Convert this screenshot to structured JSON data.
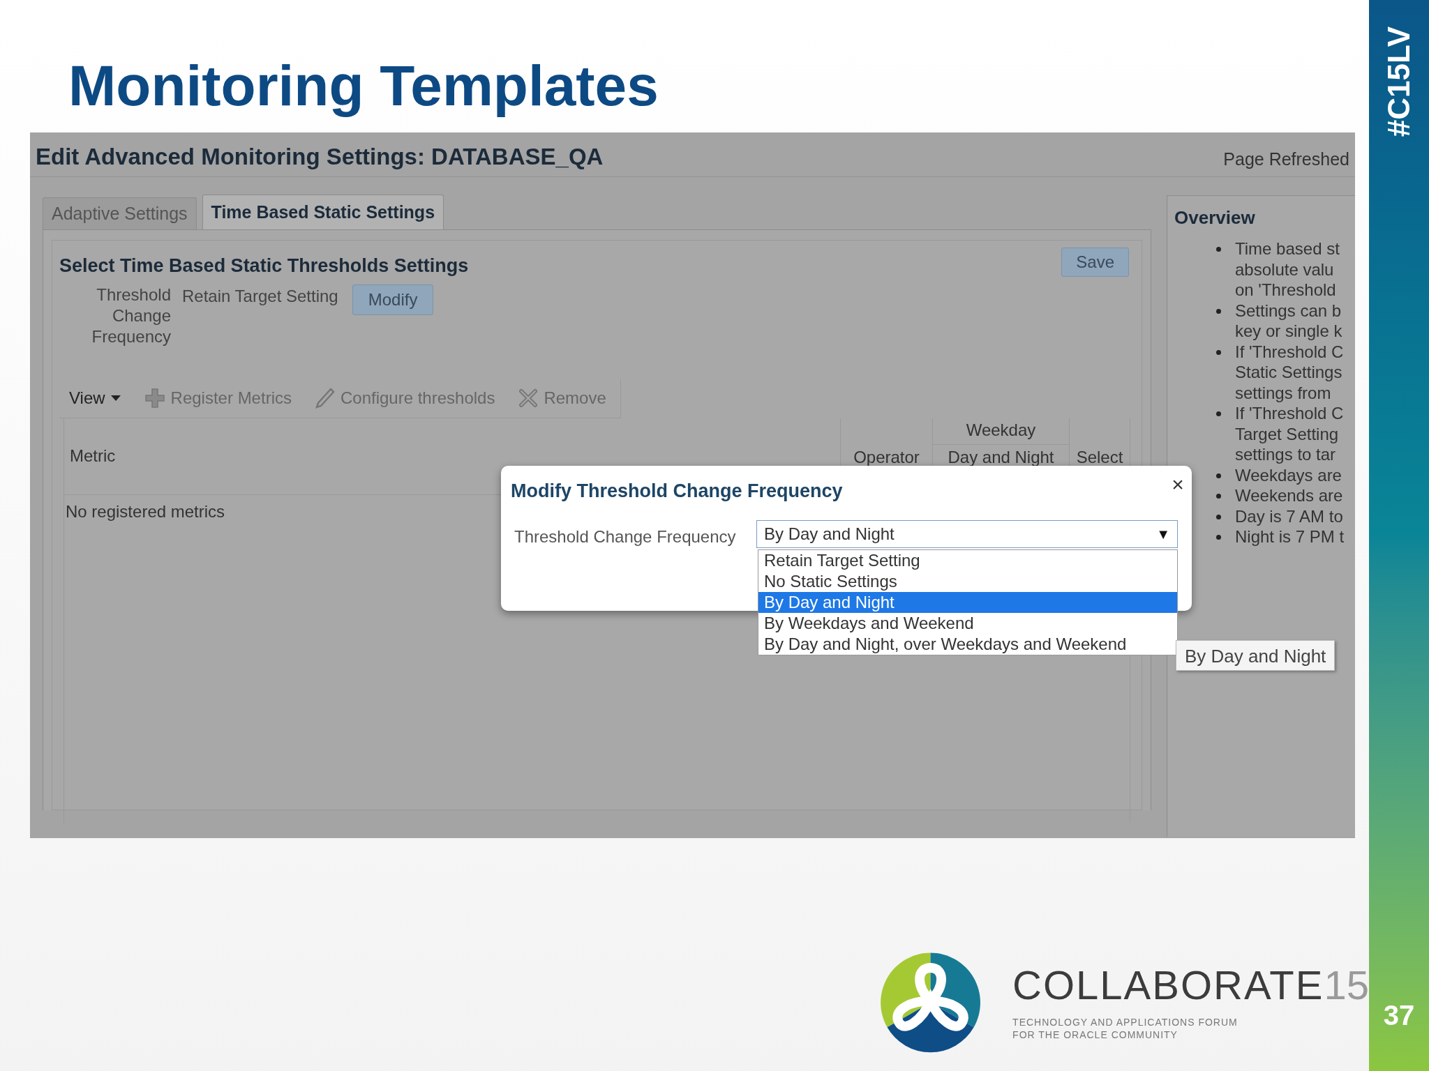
{
  "slide": {
    "title": "Monitoring Templates",
    "hashtag": "#C15LV",
    "page_number": "37"
  },
  "page": {
    "title": "Edit Advanced Monitoring Settings: DATABASE_QA",
    "refresh_label": "Page Refreshed",
    "tabs": [
      {
        "label": "Adaptive Settings",
        "selected": false
      },
      {
        "label": "Time Based Static Settings",
        "selected": true
      }
    ],
    "section": {
      "title": "Select Time Based Static Thresholds Settings",
      "save_button": "Save",
      "field_label": "Threshold Change Frequency",
      "field_value": "Retain Target Setting",
      "modify_button": "Modify"
    },
    "toolbar": [
      {
        "kind": "menu",
        "label": "View",
        "disabled": false
      },
      {
        "kind": "register",
        "label": "Register Metrics",
        "disabled": true
      },
      {
        "kind": "edit",
        "label": "Configure thresholds",
        "disabled": true
      },
      {
        "kind": "remove",
        "label": "Remove",
        "disabled": true
      }
    ],
    "table": {
      "columns": [
        {
          "label": "Metric"
        },
        {
          "label": "Operator"
        },
        {
          "group": "Weekday",
          "label": "Day and Night"
        },
        {
          "label": "Select"
        }
      ],
      "empty_text": "No registered metrics"
    }
  },
  "overview": {
    "title": "Overview",
    "items": [
      {
        "lines": [
          "Time based st",
          "absolute valu",
          "on 'Threshold"
        ]
      },
      {
        "lines": [
          "Settings can b",
          "key or single k"
        ]
      },
      {
        "lines": [
          "If 'Threshold C",
          "Static Settings",
          "settings from"
        ]
      },
      {
        "lines": [
          "If 'Threshold C",
          "Target Setting",
          "settings to tar"
        ]
      },
      {
        "lines": [
          "Weekdays are"
        ]
      },
      {
        "lines": [
          "Weekends are"
        ]
      },
      {
        "lines": [
          "Day is 7 AM to"
        ]
      },
      {
        "lines": [
          "Night is 7 PM t"
        ]
      }
    ]
  },
  "dialog": {
    "title": "Modify Threshold Change Frequency",
    "label": "Threshold Change Frequency",
    "value": "By Day and Night",
    "arrow": "▼",
    "close": "×",
    "options": [
      {
        "label": "Retain Target Setting",
        "selected": false
      },
      {
        "label": "No Static Settings",
        "selected": false
      },
      {
        "label": "By Day and Night",
        "selected": true
      },
      {
        "label": "By Weekdays and Weekend",
        "selected": false
      },
      {
        "label": "By Day and Night, over Weekdays and Weekend",
        "selected": false
      }
    ],
    "tooltip": "By Day and Night"
  },
  "footer": {
    "brand": "COLLABORATE",
    "brand_number": "15",
    "tagline": [
      "TECHNOLOGY AND APPLICATIONS FORUM",
      "FOR THE ORACLE COMMUNITY"
    ]
  }
}
